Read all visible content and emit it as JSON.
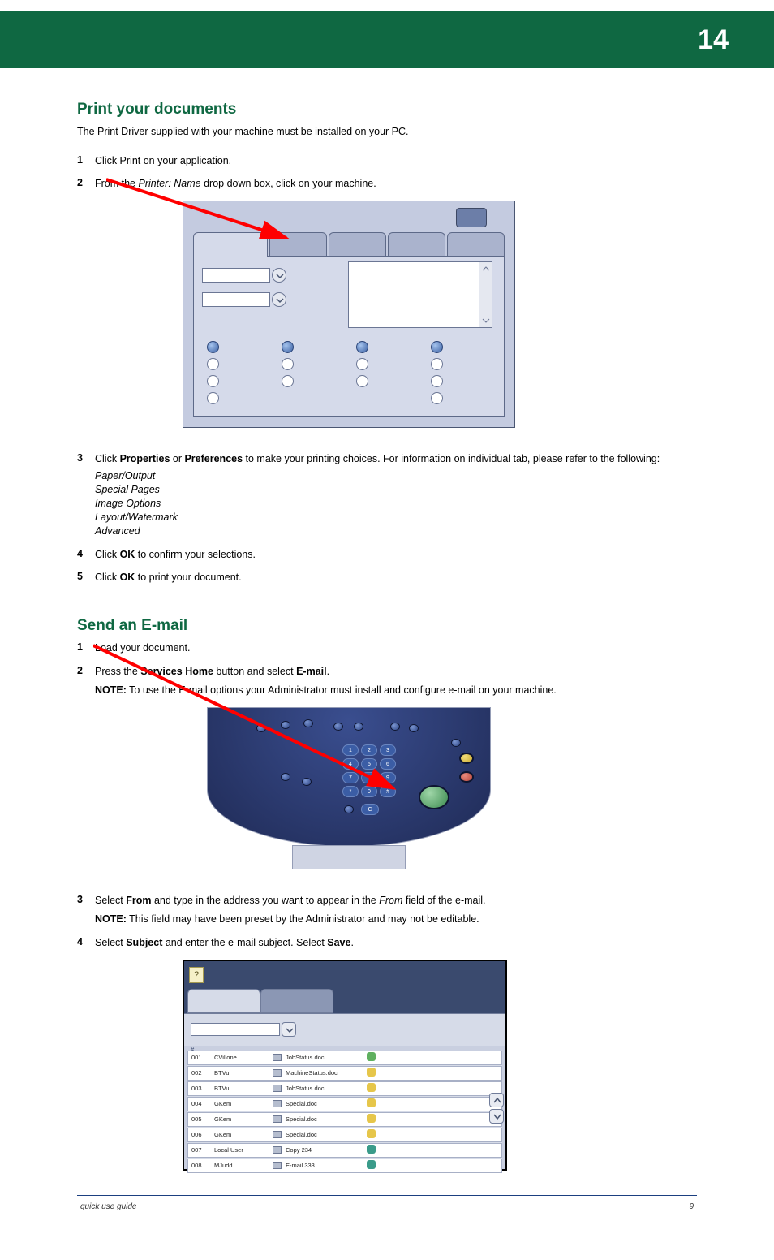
{
  "header": {
    "page_number": "14"
  },
  "section1": {
    "title": "Print your documents",
    "intro": "The Print Driver supplied with your machine must be installed on your PC.",
    "step1_num": "1",
    "step1": "Click Print on your application.",
    "step2_num": "2",
    "step2a": "From the ",
    "step2b": "Printer: Name",
    "step2c": " drop down box, click on your machine."
  },
  "section2": {
    "step3_num": "3",
    "step3a": "Click ",
    "step3b": "Properties",
    "step3c": " or ",
    "step3d": "Preferences",
    "step3e": " to make your printing choices. For information on individual tab, please refer to the following:",
    "bullets": {
      "b1": "Paper/Output",
      "b2": "Special Pages",
      "b3": "Image Options",
      "b4": "Layout/Watermark",
      "b5": "Advanced"
    },
    "step4_num": "4",
    "step4a": "Click ",
    "step4b": "OK",
    "step4c": " to confirm your selections.",
    "step5_num": "5",
    "step5a": "Click ",
    "step5b": "OK",
    "step5c": " to print your document."
  },
  "section3": {
    "title": "Send an E-mail",
    "step1_num": "1",
    "step1": "Load your document.",
    "step2_num": "2",
    "step2a": "Press the ",
    "step2b": "Services Home",
    "step2c": " button and select ",
    "step2d": "E-mail",
    "step2e": ".",
    "note_label": "NOTE:",
    "note_text": " To use the E-mail options your Administrator must install and configure e-mail on your machine.",
    "step3_num": "3",
    "step3a": "Select ",
    "step3b": "From",
    "step3c": " and type in the address you want to appear in the ",
    "step3d": "From",
    "step3e": " field of the e-mail.",
    "note2_label": "NOTE:",
    "note2_text": " This field may have been preset by the Administrator and may not be editable.",
    "step4_num": "4",
    "step4a": "Select ",
    "step4b": "Subject",
    "step4c": " and enter the e-mail subject. Select ",
    "step4d": "Save",
    "step4e": "."
  },
  "job_queue": {
    "rows": [
      {
        "id": "001",
        "owner": "CVillone",
        "doc": "JobStatus.doc",
        "status": "green"
      },
      {
        "id": "002",
        "owner": "BTVu",
        "doc": "MachineStatus.doc",
        "status": "yellow"
      },
      {
        "id": "003",
        "owner": "BTVu",
        "doc": "JobStatus.doc",
        "status": "yellow"
      },
      {
        "id": "004",
        "owner": "GKem",
        "doc": "Special.doc",
        "status": "yellow"
      },
      {
        "id": "005",
        "owner": "GKem",
        "doc": "Special.doc",
        "status": "yellow"
      },
      {
        "id": "006",
        "owner": "GKem",
        "doc": "Special.doc",
        "status": "yellow"
      },
      {
        "id": "007",
        "owner": "Local User",
        "doc": "Copy 234",
        "status": "teal"
      },
      {
        "id": "008",
        "owner": "MJudd",
        "doc": "E-mail 333",
        "status": "teal"
      }
    ]
  },
  "footer": {
    "left": "quick use guide",
    "right": "9"
  }
}
